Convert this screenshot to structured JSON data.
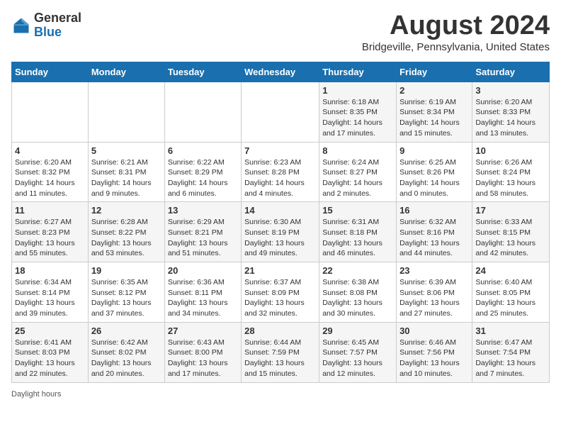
{
  "header": {
    "logo_general": "General",
    "logo_blue": "Blue",
    "title": "August 2024",
    "subtitle": "Bridgeville, Pennsylvania, United States"
  },
  "days_of_week": [
    "Sunday",
    "Monday",
    "Tuesday",
    "Wednesday",
    "Thursday",
    "Friday",
    "Saturday"
  ],
  "weeks": [
    [
      {
        "day": "",
        "info": ""
      },
      {
        "day": "",
        "info": ""
      },
      {
        "day": "",
        "info": ""
      },
      {
        "day": "",
        "info": ""
      },
      {
        "day": "1",
        "info": "Sunrise: 6:18 AM\nSunset: 8:35 PM\nDaylight: 14 hours and 17 minutes."
      },
      {
        "day": "2",
        "info": "Sunrise: 6:19 AM\nSunset: 8:34 PM\nDaylight: 14 hours and 15 minutes."
      },
      {
        "day": "3",
        "info": "Sunrise: 6:20 AM\nSunset: 8:33 PM\nDaylight: 14 hours and 13 minutes."
      }
    ],
    [
      {
        "day": "4",
        "info": "Sunrise: 6:20 AM\nSunset: 8:32 PM\nDaylight: 14 hours and 11 minutes."
      },
      {
        "day": "5",
        "info": "Sunrise: 6:21 AM\nSunset: 8:31 PM\nDaylight: 14 hours and 9 minutes."
      },
      {
        "day": "6",
        "info": "Sunrise: 6:22 AM\nSunset: 8:29 PM\nDaylight: 14 hours and 6 minutes."
      },
      {
        "day": "7",
        "info": "Sunrise: 6:23 AM\nSunset: 8:28 PM\nDaylight: 14 hours and 4 minutes."
      },
      {
        "day": "8",
        "info": "Sunrise: 6:24 AM\nSunset: 8:27 PM\nDaylight: 14 hours and 2 minutes."
      },
      {
        "day": "9",
        "info": "Sunrise: 6:25 AM\nSunset: 8:26 PM\nDaylight: 14 hours and 0 minutes."
      },
      {
        "day": "10",
        "info": "Sunrise: 6:26 AM\nSunset: 8:24 PM\nDaylight: 13 hours and 58 minutes."
      }
    ],
    [
      {
        "day": "11",
        "info": "Sunrise: 6:27 AM\nSunset: 8:23 PM\nDaylight: 13 hours and 55 minutes."
      },
      {
        "day": "12",
        "info": "Sunrise: 6:28 AM\nSunset: 8:22 PM\nDaylight: 13 hours and 53 minutes."
      },
      {
        "day": "13",
        "info": "Sunrise: 6:29 AM\nSunset: 8:21 PM\nDaylight: 13 hours and 51 minutes."
      },
      {
        "day": "14",
        "info": "Sunrise: 6:30 AM\nSunset: 8:19 PM\nDaylight: 13 hours and 49 minutes."
      },
      {
        "day": "15",
        "info": "Sunrise: 6:31 AM\nSunset: 8:18 PM\nDaylight: 13 hours and 46 minutes."
      },
      {
        "day": "16",
        "info": "Sunrise: 6:32 AM\nSunset: 8:16 PM\nDaylight: 13 hours and 44 minutes."
      },
      {
        "day": "17",
        "info": "Sunrise: 6:33 AM\nSunset: 8:15 PM\nDaylight: 13 hours and 42 minutes."
      }
    ],
    [
      {
        "day": "18",
        "info": "Sunrise: 6:34 AM\nSunset: 8:14 PM\nDaylight: 13 hours and 39 minutes."
      },
      {
        "day": "19",
        "info": "Sunrise: 6:35 AM\nSunset: 8:12 PM\nDaylight: 13 hours and 37 minutes."
      },
      {
        "day": "20",
        "info": "Sunrise: 6:36 AM\nSunset: 8:11 PM\nDaylight: 13 hours and 34 minutes."
      },
      {
        "day": "21",
        "info": "Sunrise: 6:37 AM\nSunset: 8:09 PM\nDaylight: 13 hours and 32 minutes."
      },
      {
        "day": "22",
        "info": "Sunrise: 6:38 AM\nSunset: 8:08 PM\nDaylight: 13 hours and 30 minutes."
      },
      {
        "day": "23",
        "info": "Sunrise: 6:39 AM\nSunset: 8:06 PM\nDaylight: 13 hours and 27 minutes."
      },
      {
        "day": "24",
        "info": "Sunrise: 6:40 AM\nSunset: 8:05 PM\nDaylight: 13 hours and 25 minutes."
      }
    ],
    [
      {
        "day": "25",
        "info": "Sunrise: 6:41 AM\nSunset: 8:03 PM\nDaylight: 13 hours and 22 minutes."
      },
      {
        "day": "26",
        "info": "Sunrise: 6:42 AM\nSunset: 8:02 PM\nDaylight: 13 hours and 20 minutes."
      },
      {
        "day": "27",
        "info": "Sunrise: 6:43 AM\nSunset: 8:00 PM\nDaylight: 13 hours and 17 minutes."
      },
      {
        "day": "28",
        "info": "Sunrise: 6:44 AM\nSunset: 7:59 PM\nDaylight: 13 hours and 15 minutes."
      },
      {
        "day": "29",
        "info": "Sunrise: 6:45 AM\nSunset: 7:57 PM\nDaylight: 13 hours and 12 minutes."
      },
      {
        "day": "30",
        "info": "Sunrise: 6:46 AM\nSunset: 7:56 PM\nDaylight: 13 hours and 10 minutes."
      },
      {
        "day": "31",
        "info": "Sunrise: 6:47 AM\nSunset: 7:54 PM\nDaylight: 13 hours and 7 minutes."
      }
    ]
  ],
  "footer": {
    "daylight_hours_label": "Daylight hours"
  }
}
